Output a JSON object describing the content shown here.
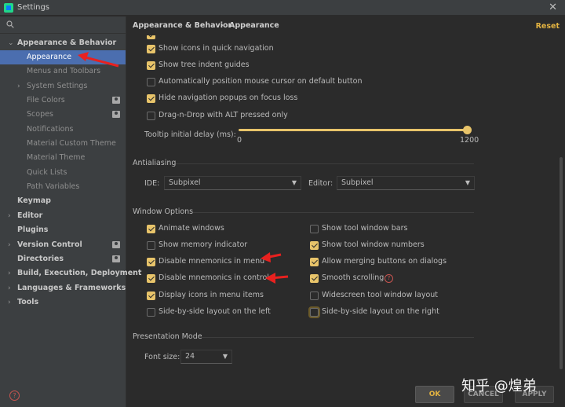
{
  "window": {
    "title": "Settings",
    "close_glyph": "✕"
  },
  "sidebar": {
    "items": [
      {
        "label": "Appearance & Behavior",
        "expanded": true
      },
      {
        "label": "Appearance",
        "selected": true
      },
      {
        "label": "Menus and Toolbars"
      },
      {
        "label": "System Settings"
      },
      {
        "label": "File Colors"
      },
      {
        "label": "Scopes"
      },
      {
        "label": "Notifications"
      },
      {
        "label": "Material Custom Theme"
      },
      {
        "label": "Material Theme"
      },
      {
        "label": "Quick Lists"
      },
      {
        "label": "Path Variables"
      },
      {
        "label": "Keymap"
      },
      {
        "label": "Editor"
      },
      {
        "label": "Plugins"
      },
      {
        "label": "Version Control"
      },
      {
        "label": "Directories"
      },
      {
        "label": "Build, Execution, Deployment"
      },
      {
        "label": "Languages & Frameworks"
      },
      {
        "label": "Tools"
      }
    ],
    "help_glyph": "?"
  },
  "breadcrumb": {
    "parent": "Appearance & Behavior",
    "separator": "›",
    "current": "Appearance"
  },
  "reset_label": "Reset",
  "options": {
    "quick_nav_icons": {
      "label": "Show icons in quick navigation",
      "checked": true
    },
    "tree_indent": {
      "label": "Show tree indent guides",
      "checked": true
    },
    "auto_mouse": {
      "label": "Automatically position mouse cursor on default button",
      "checked": false
    },
    "hide_popups": {
      "label": "Hide navigation popups on focus loss",
      "checked": true
    },
    "dnd_alt": {
      "label": "Drag-n-Drop with ALT pressed only",
      "checked": false
    },
    "tooltip_delay": {
      "label": "Tooltip initial delay (ms):",
      "min": "0",
      "max": "1200",
      "value": 1200
    }
  },
  "antialiasing": {
    "title": "Antialiasing",
    "ide_label": "IDE:",
    "ide_value": "Subpixel",
    "editor_label": "Editor:",
    "editor_value": "Subpixel",
    "arrow_glyph": "▼"
  },
  "window_options": {
    "title": "Window Options",
    "left": [
      {
        "label": "Animate windows",
        "checked": true
      },
      {
        "label": "Show memory indicator",
        "checked": false
      },
      {
        "label": "Disable mnemonics in menu",
        "checked": true
      },
      {
        "label": "Disable mnemonics in controls",
        "checked": true
      },
      {
        "label": "Display icons in menu items",
        "checked": true
      },
      {
        "label": "Side-by-side layout on the left",
        "checked": false
      }
    ],
    "right": [
      {
        "label": "Show tool window bars",
        "checked": false
      },
      {
        "label": "Show tool window numbers",
        "checked": true
      },
      {
        "label": "Allow merging buttons on dialogs",
        "checked": true
      },
      {
        "label": "Smooth scrolling",
        "checked": true
      },
      {
        "label": "Widescreen tool window layout",
        "checked": false
      },
      {
        "label": "Side-by-side layout on the right",
        "checked": false
      }
    ],
    "help_glyph": "?"
  },
  "presentation": {
    "title": "Presentation Mode",
    "font_label": "Font size:",
    "font_value": "24"
  },
  "buttons": {
    "ok": "OK",
    "cancel": "CANCEL",
    "apply": "APPLY"
  },
  "watermark": "知乎 @煌弟",
  "colors": {
    "accent": "#e8c46a",
    "selection": "#4b6eaf",
    "annotation": "#e8211f"
  }
}
